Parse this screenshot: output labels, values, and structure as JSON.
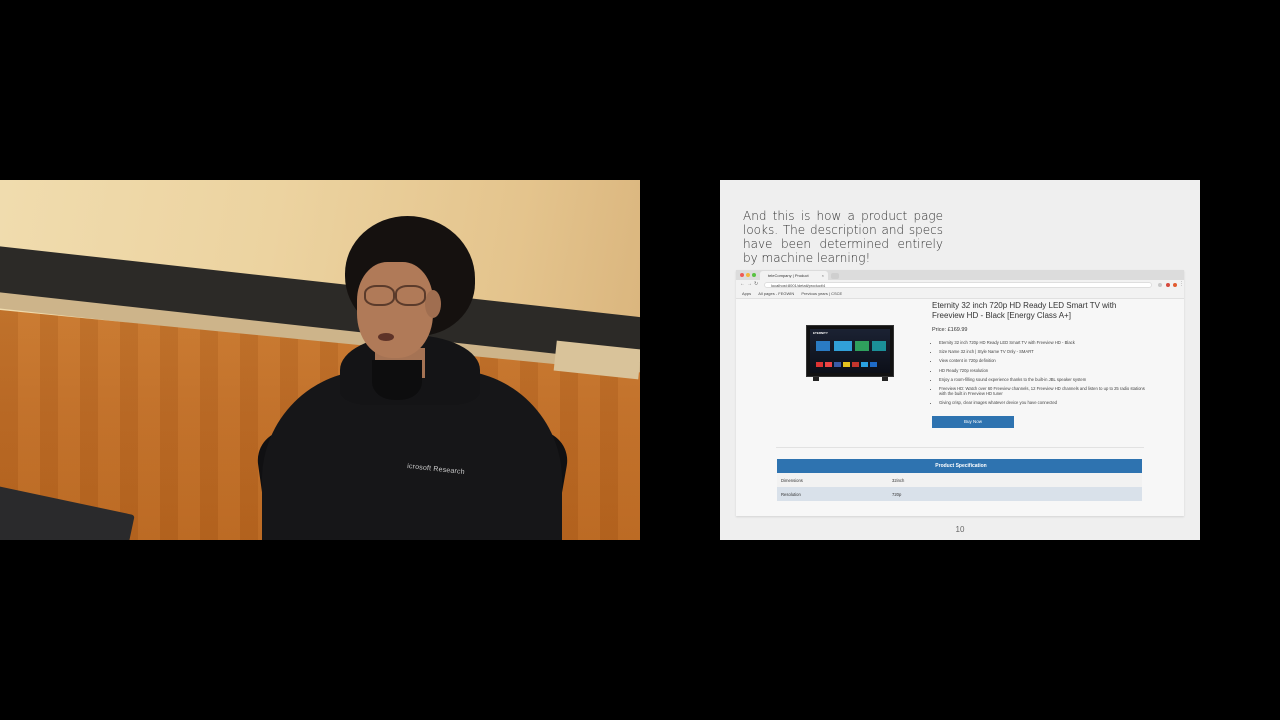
{
  "video": {
    "shirt_logo": "icrosoft Research"
  },
  "slide": {
    "caption": "And this is how a product page looks. The description and specs have been determined entirely by machine learning!",
    "page_number": "10",
    "browser": {
      "tab_title": "teleCompany | Product",
      "tab_close": "×",
      "address": "localhost:8001/detail/product/4",
      "bookmarks": [
        "Apps",
        "All pages - FEGWIN",
        "Previous years | CSCE"
      ],
      "product": {
        "title": "Eternity 32 inch 720p HD Ready LED Smart TV with Freeview HD - Black [Energy Class A+]",
        "price": "Price: £169.99",
        "tv_brand": "ETERNITY",
        "bullets": [
          "Eternity 32 inch 720p HD Ready LED Smart TV with Freeview HD - Black",
          "Size Name 32 inch | Style Name TV Only - SMART",
          "View content in 720p definition",
          "HD Ready 720p resolution",
          "Enjoy a room-filling sound experience thanks to the built-in JBL speaker system",
          "Freeview HD: Watch over 60 Freeview channels, 12 Freeview HD channels and listen to up to 25 radio stations with the built in Freeview HD tuner",
          "Giving crisp, clear images whatever device you have connected"
        ],
        "buy_label": "Buy Now"
      },
      "spec": {
        "header": "Product Specification",
        "rows": [
          {
            "label": "Dimensions",
            "value": "32inch"
          },
          {
            "label": "Resolution",
            "value": "720p"
          }
        ]
      }
    }
  },
  "colors": {
    "accent_blue": "#2e73b0",
    "slide_background": "#efefef"
  }
}
